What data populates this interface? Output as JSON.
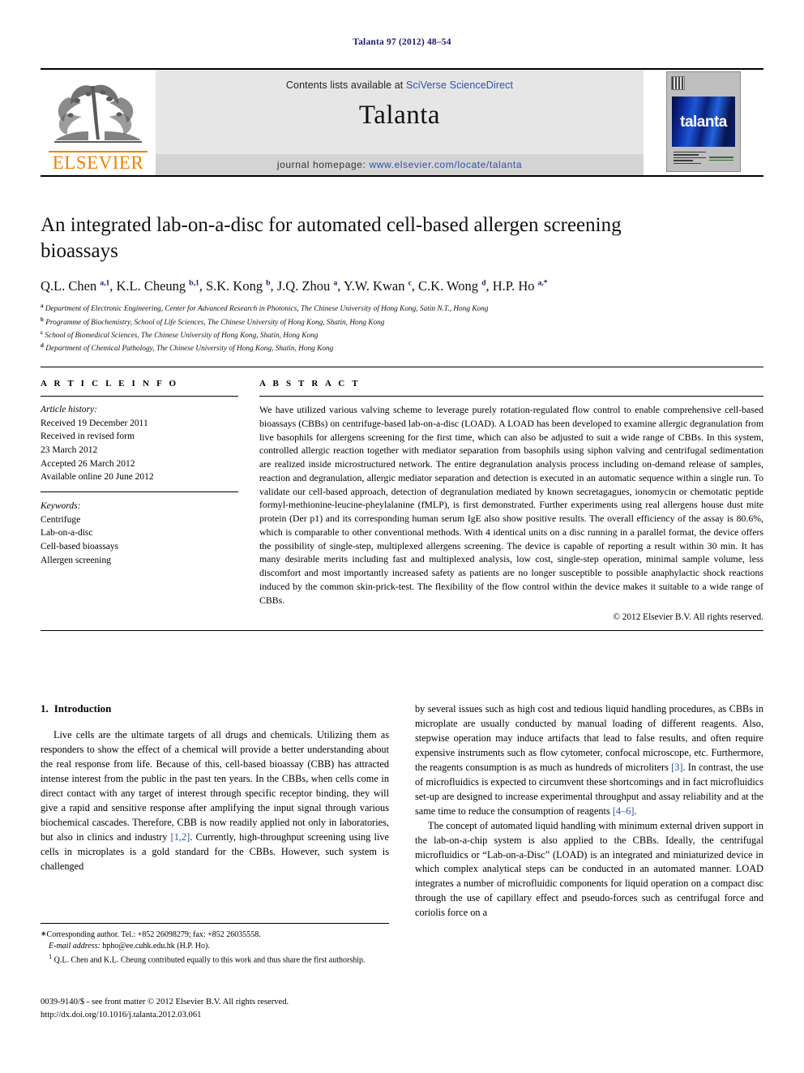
{
  "running_head": "Talanta 97 (2012) 48–54",
  "masthead": {
    "contents_prefix": "Contents lists available at ",
    "contents_link": "SciVerse ScienceDirect",
    "journal_title": "Talanta",
    "homepage_label": "journal homepage:",
    "homepage_url": "www.elsevier.com/locate/talanta",
    "publisher_wordmark": "ELSEVIER",
    "cover_title": "talanta"
  },
  "article": {
    "title": "An integrated lab-on-a-disc for automated cell-based allergen screening bioassays",
    "authors_html": "Q.L. Chen <sup>a,1</sup>, K.L. Cheung <sup>b,1</sup>, S.K. Kong <sup>b</sup>, J.Q. Zhou <sup>a</sup>, Y.W. Kwan <sup>c</sup>, C.K. Wong <sup>d</sup>, H.P. Ho <sup>a,*</sup>",
    "affiliations": [
      {
        "marker": "a",
        "text": "Department of Electronic Engineering, Center for Advanced Research in Photonics, The Chinese University of Hong Kong, Satin N.T., Hong Kong"
      },
      {
        "marker": "b",
        "text": "Programme of Biochemistry, School of Life Sciences, The Chinese University of Hong Kong, Shatin, Hong Kong"
      },
      {
        "marker": "c",
        "text": "School of Biomedical Sciences, The Chinese University of Hong Kong, Shatin, Hong Kong"
      },
      {
        "marker": "d",
        "text": "Department of Chemical Pathology, The Chinese University of Hong Kong, Shatin, Hong Kong"
      }
    ]
  },
  "article_info": {
    "heading": "A R T I C L E  I N F O",
    "history_label": "Article history:",
    "history": [
      "Received 19 December 2011",
      "Received in revised form",
      "23 March 2012",
      "Accepted 26 March 2012",
      "Available online 20 June 2012"
    ],
    "keywords_label": "Keywords:",
    "keywords": [
      "Centrifuge",
      "Lab-on-a-disc",
      "Cell-based bioassays",
      "Allergen screening"
    ]
  },
  "abstract": {
    "heading": "A B S T R A C T",
    "text": "We have utilized various valving scheme to leverage purely rotation-regulated flow control to enable comprehensive cell-based bioassays (CBBs) on centrifuge-based lab-on-a-disc (LOAD). A LOAD has been developed to examine allergic degranulation from live basophils for allergens screening for the first time, which can also be adjusted to suit a wide range of CBBs. In this system, controlled allergic reaction together with mediator separation from basophils using siphon valving and centrifugal sedimentation are realized inside microstructured network. The entire degranulation analysis process including on-demand release of samples, reaction and degranulation, allergic mediator separation and detection is executed in an automatic sequence within a single run. To validate our cell-based approach, detection of degranulation mediated by known secretagagues, ionomycin or chemotatic peptide formyl-methionine-leucine-pheylalanine (fMLP), is first demonstrated. Further experiments using real allergens house dust mite protein (Der p1) and its corresponding human serum IgE also show positive results. The overall efficiency of the assay is 80.6%, which is comparable to other conventional methods. With 4 identical units on a disc running in a parallel format, the device offers the possibility of single-step, multiplexed allergens screening. The device is capable of reporting a result within 30 min. It has many desirable merits including fast and multiplexed analysis, low cost, single-step operation, minimal sample volume, less discomfort and most importantly increased safety as patients are no longer susceptible to possible anaphylactic shock reactions induced by the common skin-prick-test. The flexibility of the flow control within the device makes it suitable to a wide range of CBBs.",
    "copyright": "© 2012 Elsevier B.V. All rights reserved."
  },
  "introduction": {
    "number": "1.",
    "heading": "Introduction",
    "paragraph_1_left": "Live cells are the ultimate targets of all drugs and chemicals. Utilizing them as responders to show the effect of a chemical will provide a better understanding about the real response from life. Because of this, cell-based bioassay (CBB) has attracted intense interest from the public in the past ten years. In the CBBs, when cells come in direct contact with any target of interest through specific receptor binding, they will give a rapid and sensitive response after amplifying the input signal through various biochemical cascades. Therefore, CBB is now readily applied not only in laboratories, but also in clinics and industry [1,2]. Currently, high-throughput screening using live cells in microplates is a gold standard for the CBBs. However, such system is challenged",
    "paragraph_1_right": "by several issues such as high cost and tedious liquid handling procedures, as CBBs in microplate are usually conducted by manual loading of different reagents. Also, stepwise operation may induce artifacts that lead to false results, and often require expensive instruments such as flow cytometer, confocal microscope, etc. Furthermore, the reagents consumption is as much as hundreds of microliters [3]. In contrast, the use of microfluidics is expected to circumvent these shortcomings and in fact microfluidics set-up are designed to increase experimental throughput and assay reliability and at the same time to reduce the consumption of reagents [4–6].",
    "paragraph_2_right": "The concept of automated liquid handling with minimum external driven support in the lab-on-a-chip system is also applied to the CBBs. Ideally, the centrifugal microfluidics or “Lab-on-a-Disc” (LOAD) is an integrated and miniaturized device in which complex analytical steps can be conducted in an automated manner. LOAD integrates a number of microfluidic components for liquid operation on a compact disc through the use of capillary effect and pseudo-forces such as centrifugal force and coriolis force on a"
  },
  "footnotes": {
    "corresponding": "Corresponding author. Tel.: +852 26098279; fax: +852 26035558.",
    "email_label": "E-mail address:",
    "email": "hpho@ee.cuhk.edu.hk (H.P. Ho).",
    "equal_contribution": "Q.L. Chen and K.L. Cheung contributed equally to this work and thus share the first authorship."
  },
  "footer": {
    "issn_line": "0039-9140/$ - see front matter © 2012 Elsevier B.V. All rights reserved.",
    "doi_line": "http://dx.doi.org/10.1016/j.talanta.2012.03.061"
  },
  "colors": {
    "link": "#2b4fb0",
    "running_head": "#1a1a6e",
    "elsevier_orange": "#ef8200",
    "masthead_grey": "#e6e6e6",
    "strip_grey": "#d4d4d4"
  }
}
